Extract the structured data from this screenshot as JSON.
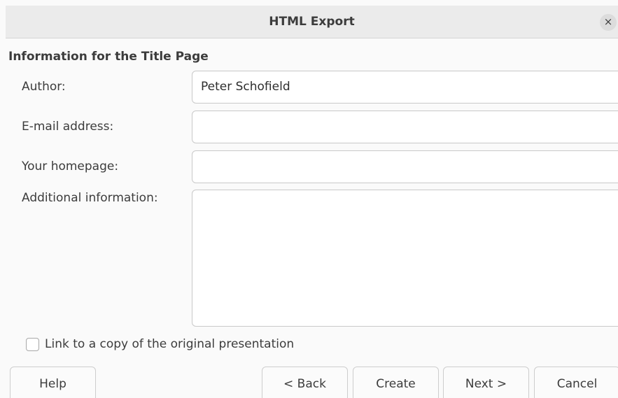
{
  "window": {
    "title": "HTML Export",
    "close_glyph": "×"
  },
  "section": {
    "heading": "Information for the Title Page"
  },
  "form": {
    "author_label": "Author:",
    "author_value": "Peter Schofield",
    "email_label": "E-mail address:",
    "email_value": "",
    "homepage_label": "Your homepage:",
    "homepage_value": "",
    "additional_label": "Additional information:",
    "additional_value": ""
  },
  "checkbox": {
    "label": "Link to a copy of the original presentation",
    "checked": false
  },
  "buttons": {
    "help": "Help",
    "back": "< Back",
    "create": "Create",
    "next": "Next >",
    "cancel": "Cancel"
  },
  "icons": {
    "close": "close-icon",
    "checkbox": "checkbox-icon"
  }
}
